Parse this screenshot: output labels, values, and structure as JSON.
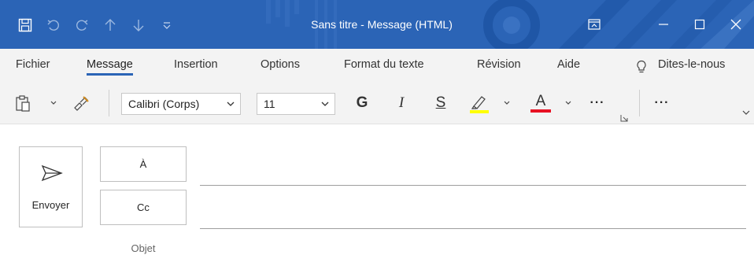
{
  "window": {
    "title": "Sans titre  -  Message (HTML)",
    "accent_color": "#2b64b6"
  },
  "quick_access": [
    {
      "icon": "save-icon"
    },
    {
      "icon": "undo-icon"
    },
    {
      "icon": "redo-icon"
    },
    {
      "icon": "arrow-up-icon"
    },
    {
      "icon": "arrow-down-icon"
    },
    {
      "icon": "customize-qat-icon"
    }
  ],
  "window_controls": [
    {
      "icon": "ribbon-display-options-icon"
    },
    {
      "icon": "minimize-icon"
    },
    {
      "icon": "maximize-icon"
    },
    {
      "icon": "close-icon"
    }
  ],
  "tabs": [
    {
      "label": "Fichier",
      "active": false
    },
    {
      "label": "Message",
      "active": true
    },
    {
      "label": "Insertion",
      "active": false
    },
    {
      "label": "Options",
      "active": false
    },
    {
      "label": "Format du texte",
      "active": false
    },
    {
      "label": "Révision",
      "active": false
    },
    {
      "label": "Aide",
      "active": false
    }
  ],
  "tell_me": {
    "icon": "lightbulb-icon",
    "label": "Dites-le-nous"
  },
  "ribbon": {
    "paste_icon": "paste-icon",
    "format_painter_icon": "format-painter-icon",
    "font_name": "Calibri (Corps)",
    "font_size": "11",
    "bold": "G",
    "italic": "I",
    "underline": "S",
    "highlight_color": "#ffff00",
    "font_color_letter": "A",
    "font_color": "#e81123",
    "more": "···",
    "more2": "···"
  },
  "compose": {
    "send_label": "Envoyer",
    "to_label": "À",
    "cc_label": "Cc",
    "subject_label": "Objet"
  }
}
